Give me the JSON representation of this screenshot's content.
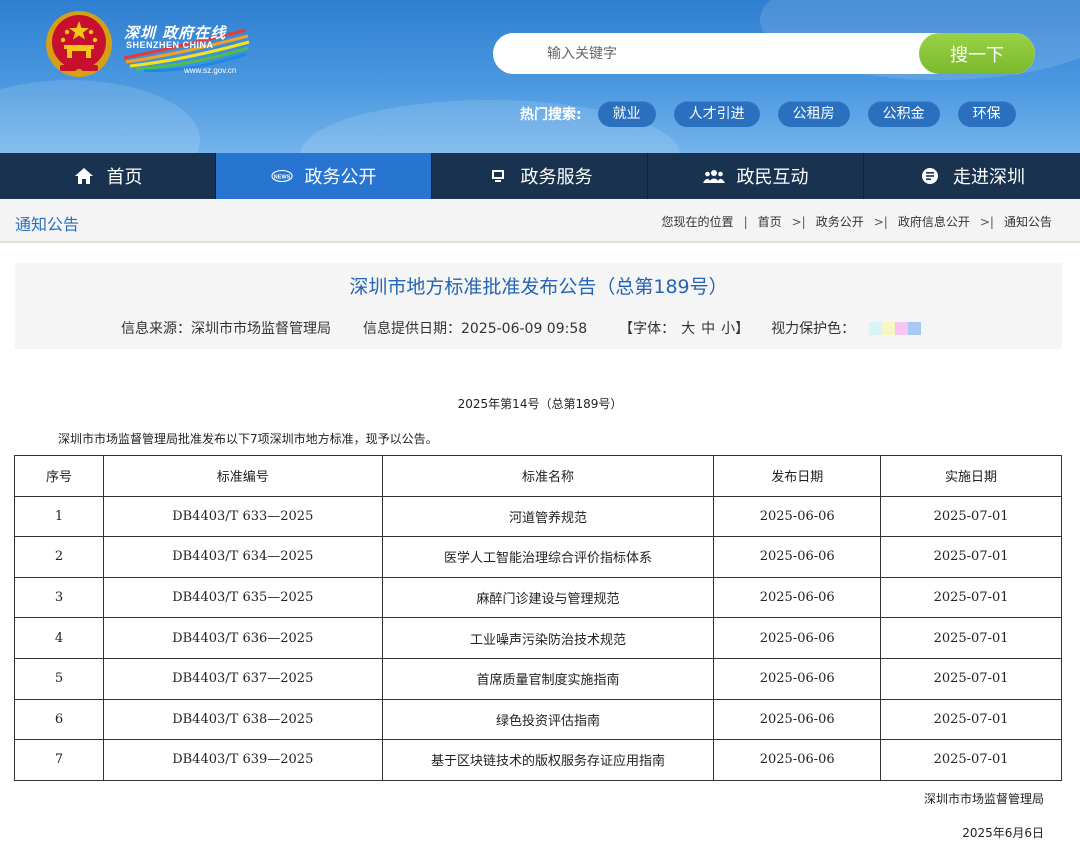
{
  "header": {
    "logo_cn": "深圳 政府在线",
    "logo_en": "SHENZHEN CHINA",
    "logo_url": "www.sz.gov.cn",
    "search_placeholder": "输入关键字",
    "search_button": "搜一下",
    "hot_label": "热门搜索:",
    "hot_tags": [
      "就业",
      "人才引进",
      "公租房",
      "公积金",
      "环保"
    ]
  },
  "nav": {
    "items": [
      {
        "label": "首页",
        "icon": "home-icon"
      },
      {
        "label": "政务公开",
        "icon": "news-icon",
        "active": true
      },
      {
        "label": "政务服务",
        "icon": "monitor-icon"
      },
      {
        "label": "政民互动",
        "icon": "people-icon"
      },
      {
        "label": "走进深圳",
        "icon": "info-icon"
      }
    ]
  },
  "breadcrumb": {
    "section": "通知公告",
    "prefix": "您现在的位置",
    "items": [
      "首页",
      "政务公开",
      "政府信息公开",
      "通知公告"
    ]
  },
  "article": {
    "title": "深圳市地方标准批准发布公告（总第189号）",
    "source_label": "信息来源：深圳市市场监督管理局",
    "date_label": "信息提供日期：2025-06-09 09:58",
    "font_label_open": "【字体：",
    "font_sizes": [
      "大",
      "中",
      "小"
    ],
    "font_label_close": "】",
    "eye_label": "视力保护色：",
    "eye_colors": [
      "#d9f3fb",
      "#f6f7c4",
      "#f8c4f2",
      "#a9c8f3"
    ],
    "issue": "2025年第14号（总第189号）",
    "intro": "深圳市市场监督管理局批准发布以下7项深圳市地方标准，现予以公告。",
    "table": {
      "headers": [
        "序号",
        "标准编号",
        "标准名称",
        "发布日期",
        "实施日期"
      ],
      "rows": [
        [
          "1",
          "DB4403/T 633—2025",
          "河道管养规范",
          "2025-06-06",
          "2025-07-01"
        ],
        [
          "2",
          "DB4403/T 634—2025",
          "医学人工智能治理综合评价指标体系",
          "2025-06-06",
          "2025-07-01"
        ],
        [
          "3",
          "DB4403/T 635—2025",
          "麻醉门诊建设与管理规范",
          "2025-06-06",
          "2025-07-01"
        ],
        [
          "4",
          "DB4403/T 636—2025",
          "工业噪声污染防治技术规范",
          "2025-06-06",
          "2025-07-01"
        ],
        [
          "5",
          "DB4403/T 637—2025",
          "首席质量官制度实施指南",
          "2025-06-06",
          "2025-07-01"
        ],
        [
          "6",
          "DB4403/T 638—2025",
          "绿色投资评估指南",
          "2025-06-06",
          "2025-07-01"
        ],
        [
          "7",
          "DB4403/T 639—2025",
          "基于区块链技术的版权服务存证应用指南",
          "2025-06-06",
          "2025-07-01"
        ]
      ]
    },
    "signature": "深圳市市场监督管理局",
    "sign_date": "2025年6月6日"
  },
  "colors": {
    "nav_bg": "#18324f",
    "nav_active": "#2775d0",
    "title_blue": "#2464b4",
    "search_green": "#85c236"
  }
}
